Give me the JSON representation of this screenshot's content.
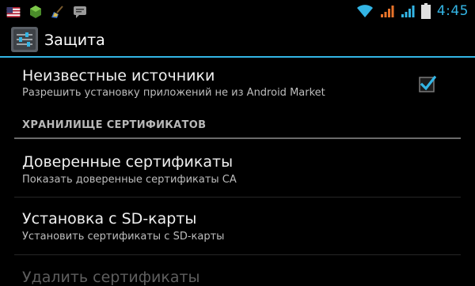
{
  "status_bar": {
    "time": "4:45",
    "left_icons": [
      "usa-flag-icon",
      "android-icon",
      "broom-icon",
      "message-icon"
    ],
    "right_icons": [
      "wifi-icon",
      "signal-icon",
      "signal-icon",
      "battery-icon"
    ],
    "accent_color": "#33b5e5"
  },
  "action_bar": {
    "title": "Защита",
    "icon": "settings-sliders-icon"
  },
  "settings": {
    "unknown_sources": {
      "title": "Неизвестные источники",
      "summary": "Разрешить установку приложений не из Android Market",
      "checked": true
    },
    "section_header": "ХРАНИЛИЩЕ СЕРТИФИКАТОВ",
    "trusted_certs": {
      "title": "Доверенные сертификаты",
      "summary": "Показать доверенные сертификаты CA"
    },
    "install_sd": {
      "title": "Установка с SD-карты",
      "summary": "Установить сертификаты с SD-карты"
    },
    "clear_certs": {
      "title": "Удалить сертификаты",
      "enabled": false
    }
  }
}
